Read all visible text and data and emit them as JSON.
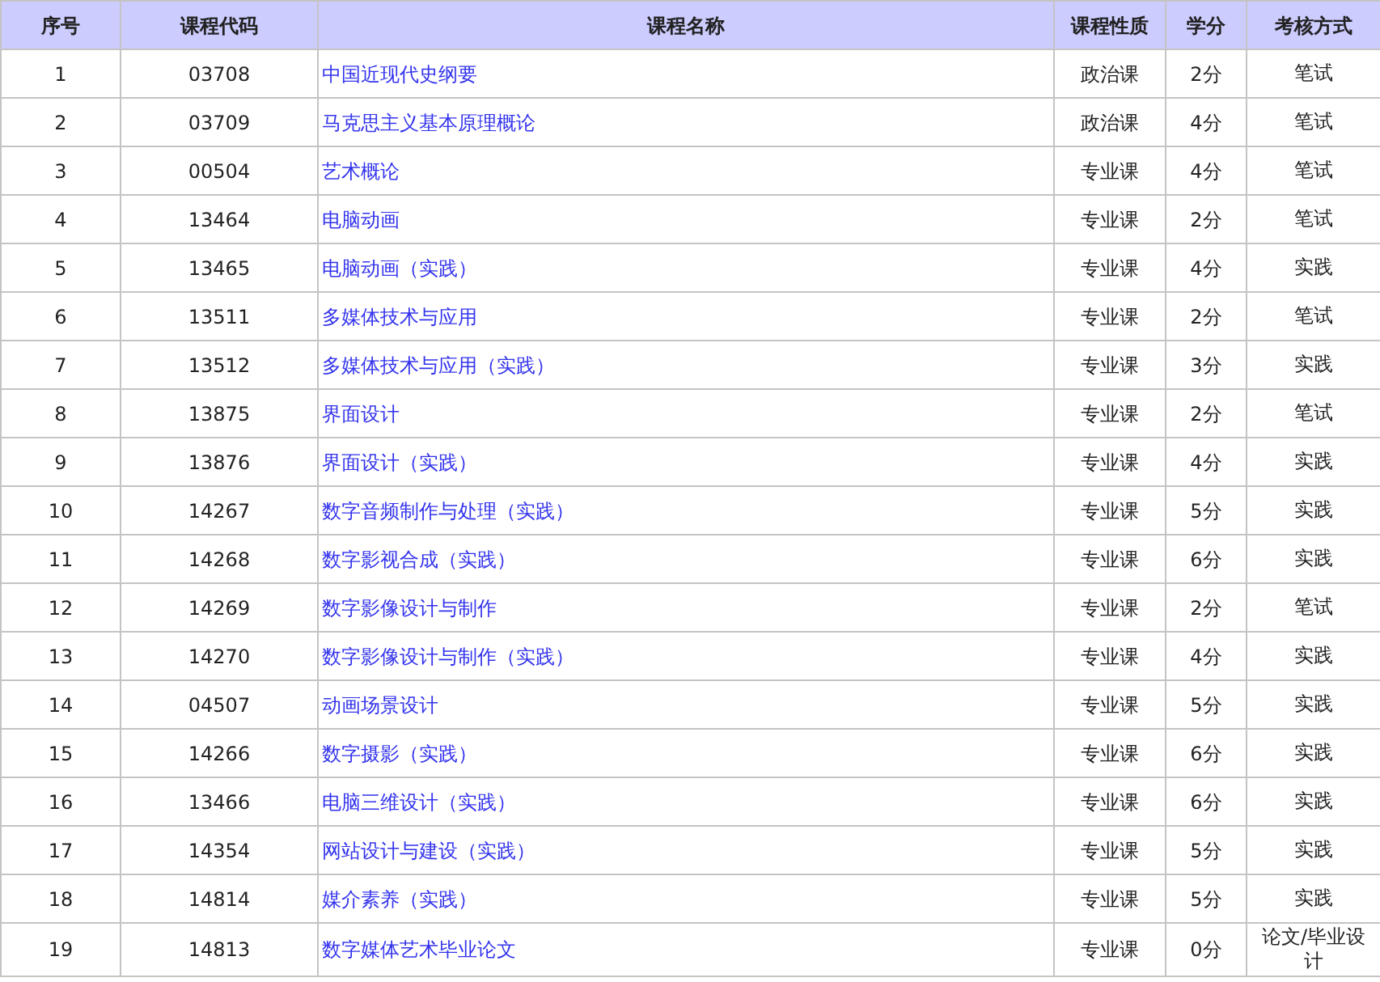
{
  "table": {
    "columns": [
      "序号",
      "课程代码",
      "课程名称",
      "课程性质",
      "学分",
      "考核方式"
    ],
    "rows": [
      {
        "index": "1",
        "code": "03708",
        "name": "中国近现代史纲要",
        "type": "政治课",
        "credits": "2分",
        "exam": "笔试"
      },
      {
        "index": "2",
        "code": "03709",
        "name": "马克思主义基本原理概论",
        "type": "政治课",
        "credits": "4分",
        "exam": "笔试"
      },
      {
        "index": "3",
        "code": "00504",
        "name": "艺术概论",
        "type": "专业课",
        "credits": "4分",
        "exam": "笔试"
      },
      {
        "index": "4",
        "code": "13464",
        "name": "电脑动画",
        "type": "专业课",
        "credits": "2分",
        "exam": "笔试"
      },
      {
        "index": "5",
        "code": "13465",
        "name": "电脑动画（实践）",
        "type": "专业课",
        "credits": "4分",
        "exam": "实践"
      },
      {
        "index": "6",
        "code": "13511",
        "name": "多媒体技术与应用",
        "type": "专业课",
        "credits": "2分",
        "exam": "笔试"
      },
      {
        "index": "7",
        "code": "13512",
        "name": "多媒体技术与应用（实践）",
        "type": "专业课",
        "credits": "3分",
        "exam": "实践"
      },
      {
        "index": "8",
        "code": "13875",
        "name": "界面设计",
        "type": "专业课",
        "credits": "2分",
        "exam": "笔试"
      },
      {
        "index": "9",
        "code": "13876",
        "name": "界面设计（实践）",
        "type": "专业课",
        "credits": "4分",
        "exam": "实践"
      },
      {
        "index": "10",
        "code": "14267",
        "name": "数字音频制作与处理（实践）",
        "type": "专业课",
        "credits": "5分",
        "exam": "实践"
      },
      {
        "index": "11",
        "code": "14268",
        "name": "数字影视合成（实践）",
        "type": "专业课",
        "credits": "6分",
        "exam": "实践"
      },
      {
        "index": "12",
        "code": "14269",
        "name": "数字影像设计与制作",
        "type": "专业课",
        "credits": "2分",
        "exam": "笔试"
      },
      {
        "index": "13",
        "code": "14270",
        "name": "数字影像设计与制作（实践）",
        "type": "专业课",
        "credits": "4分",
        "exam": "实践"
      },
      {
        "index": "14",
        "code": "04507",
        "name": "动画场景设计",
        "type": "专业课",
        "credits": "5分",
        "exam": "实践"
      },
      {
        "index": "15",
        "code": "14266",
        "name": "数字摄影（实践）",
        "type": "专业课",
        "credits": "6分",
        "exam": "实践"
      },
      {
        "index": "16",
        "code": "13466",
        "name": "电脑三维设计（实践）",
        "type": "专业课",
        "credits": "6分",
        "exam": "实践"
      },
      {
        "index": "17",
        "code": "14354",
        "name": "网站设计与建设（实践）",
        "type": "专业课",
        "credits": "5分",
        "exam": "实践"
      },
      {
        "index": "18",
        "code": "14814",
        "name": "媒介素养（实践）",
        "type": "专业课",
        "credits": "5分",
        "exam": "实践"
      },
      {
        "index": "19",
        "code": "14813",
        "name": "数字媒体艺术毕业论文",
        "type": "专业课",
        "credits": "0分",
        "exam": "论文/毕业设计"
      }
    ]
  }
}
